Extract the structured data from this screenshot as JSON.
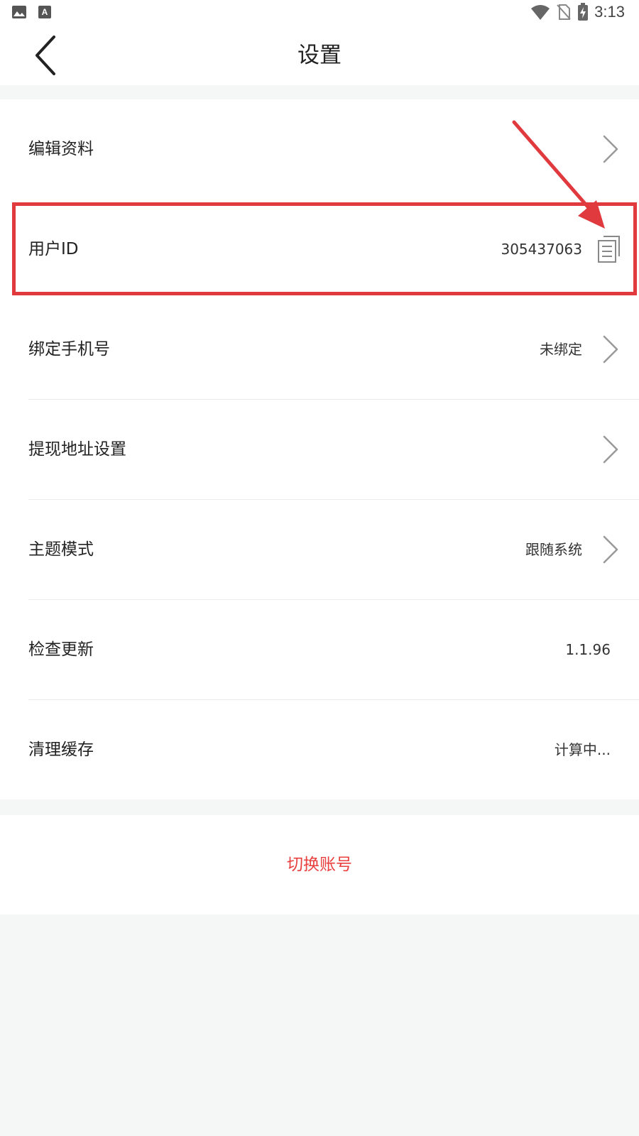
{
  "status_bar": {
    "time": "3:13",
    "left_icons": [
      "image-icon",
      "keyboard-a-icon"
    ],
    "right_icons": [
      "wifi-icon",
      "no-sim-icon",
      "battery-charging-icon"
    ]
  },
  "header": {
    "title": "设置",
    "back_icon": "chevron-left-icon"
  },
  "settings": {
    "items": [
      {
        "key": "edit-profile",
        "label": "编辑资料",
        "value": "",
        "trailing": "chevron"
      },
      {
        "key": "user-id",
        "label": "用户ID",
        "value": "305437063",
        "trailing": "copy"
      },
      {
        "key": "bind-phone",
        "label": "绑定手机号",
        "value": "未绑定",
        "trailing": "chevron"
      },
      {
        "key": "withdraw-address",
        "label": "提现地址设置",
        "value": "",
        "trailing": "chevron"
      },
      {
        "key": "theme-mode",
        "label": "主题模式",
        "value": "跟随系统",
        "trailing": "chevron"
      },
      {
        "key": "check-update",
        "label": "检查更新",
        "value": "1.1.96",
        "trailing": "none"
      },
      {
        "key": "clear-cache",
        "label": "清理缓存",
        "value": "计算中...",
        "trailing": "none"
      }
    ]
  },
  "actions": {
    "switch_account": "切换账号"
  },
  "colors": {
    "accent_red": "#e8403e",
    "annotation_red": "#e03a3e",
    "background": "#f5f6f6",
    "card": "#ffffff"
  }
}
